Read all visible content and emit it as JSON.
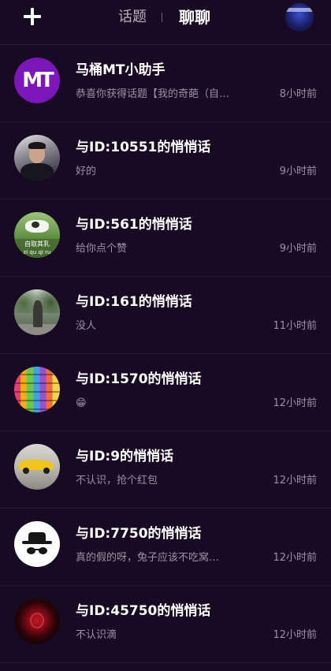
{
  "header": {
    "add_icon": "plus-icon",
    "tab_topics": "话题",
    "tab_chat": "聊聊",
    "profile_icon": "profile-avatar"
  },
  "chats": [
    {
      "name": "马桶MT小助手",
      "preview": "恭喜你获得话题【我的奇葩（自…",
      "time": "8小时前",
      "avatar": "mt-logo",
      "avatar_text": "MT"
    },
    {
      "name": "与ID:10551的悄悄话",
      "preview": "好的",
      "time": "9小时前",
      "avatar": "person-photo"
    },
    {
      "name": "与ID:561的悄悄话",
      "preview": "给你点个赞",
      "time": "9小时前",
      "avatar": "cow-photo",
      "avatar_caption_1": "自取其乳",
      "avatar_caption_2": "zi qu qi ru"
    },
    {
      "name": "与ID:161的悄悄话",
      "preview": "没人",
      "time": "11小时前",
      "avatar": "statue-photo"
    },
    {
      "name": "与ID:1570的悄悄话",
      "preview": "😁",
      "time": "12小时前",
      "avatar": "macaron-photo"
    },
    {
      "name": "与ID:9的悄悄话",
      "preview": "不认识，抢个红包",
      "time": "12小时前",
      "avatar": "car-photo"
    },
    {
      "name": "与ID:7750的悄悄话",
      "preview": "真的假的呀，兔子应该不吃窝…",
      "time": "12小时前",
      "avatar": "spy-icon"
    },
    {
      "name": "与ID:45750的悄悄话",
      "preview": "不认识滴",
      "time": "12小时前",
      "avatar": "rose-photo"
    }
  ]
}
